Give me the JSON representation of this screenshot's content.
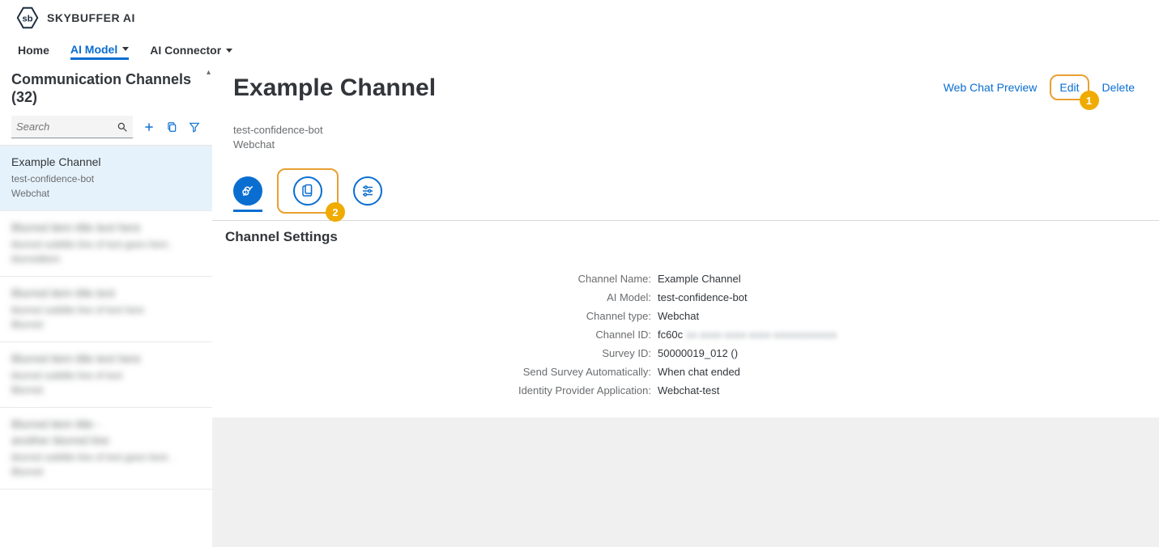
{
  "brand": {
    "name": "SKYBUFFER AI"
  },
  "topnav": {
    "home": "Home",
    "ai_model": "AI Model",
    "ai_connector": "AI Connector"
  },
  "sidebar": {
    "title_line1": "Communication Channels",
    "title_line2": "(32)",
    "search_placeholder": "Search",
    "items": [
      {
        "title": "Example Channel",
        "sub1": "test-confidence-bot",
        "sub2": "Webchat",
        "selected": true
      },
      {
        "title": "Blurred item title text here",
        "sub1": "blurred subtitle line of text goes here .",
        "sub2": "blurreditem",
        "blurred": true
      },
      {
        "title": "Blurred item title text",
        "sub1": "blurred subtitle line of text here",
        "sub2": "Blurred",
        "blurred": true
      },
      {
        "title": "Blurred item title text here",
        "sub1": "blurred subtitle line of text",
        "sub2": "Blurred",
        "blurred": true
      },
      {
        "title": "Blurred item title -",
        "title2": "another blurred line",
        "sub1": "blurred subtitle line of text goes here .",
        "sub2": "Blurred",
        "blurred": true
      }
    ]
  },
  "content": {
    "title": "Example Channel",
    "actions": {
      "preview": "Web Chat Preview",
      "edit": "Edit",
      "delete": "Delete"
    },
    "subtitle_line1": "test-confidence-bot",
    "subtitle_line2": "Webchat",
    "section_title": "Channel Settings",
    "settings": [
      {
        "label": "Channel Name:",
        "value": "Example Channel"
      },
      {
        "label": "AI Model:",
        "value": "test-confidence-bot"
      },
      {
        "label": "Channel type:",
        "value": "Webchat"
      },
      {
        "label": "Channel ID:",
        "value_prefix": "fc60c",
        "value_blur": "xx-xxxx-xxxx-xxxx-xxxxxxxxxxxx"
      },
      {
        "label": "Survey ID:",
        "value": "50000019_012 ()"
      },
      {
        "label": "Send Survey Automatically:",
        "value": "When chat ended"
      },
      {
        "label": "Identity Provider Application:",
        "value": "Webchat-test"
      }
    ],
    "callouts": {
      "edit_num": "1",
      "tab_num": "2"
    }
  }
}
